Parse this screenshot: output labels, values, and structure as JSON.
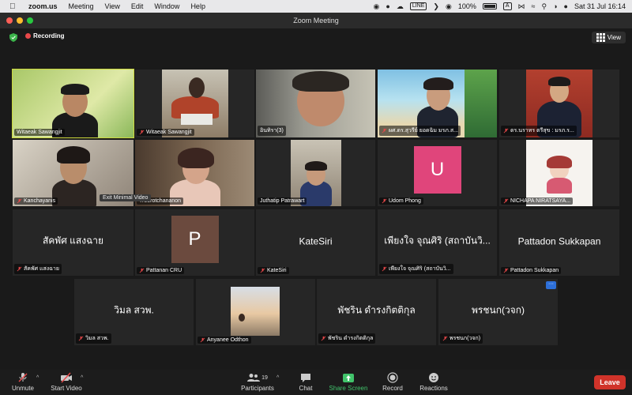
{
  "menubar": {
    "app": "zoom.us",
    "items": [
      "Meeting",
      "View",
      "Edit",
      "Window",
      "Help"
    ],
    "battery": "100%",
    "clock": "Sat 31 Jul  16:14",
    "line_badge": "LINE",
    "input_badge": "A"
  },
  "window": {
    "title": "Zoom Meeting"
  },
  "topbar": {
    "recording": "Recording",
    "view": "View"
  },
  "participants": [
    {
      "name": "Witaeak Sawangjit",
      "muted": false,
      "video": true,
      "active": true
    },
    {
      "name": "Witaeak Sawangjit",
      "muted": true,
      "video": true
    },
    {
      "name": "อินทิรา(3)",
      "muted": false,
      "video": true
    },
    {
      "name": "ผศ.ดร.สุวรีย์ ยอดฉิม มรภ.ส...",
      "muted": true,
      "video": true
    },
    {
      "name": "ดร.นราทร ตรีสุข : มรภ.ร...",
      "muted": true,
      "video": true
    },
    {
      "name": "Kanchayanis",
      "muted": true,
      "video": true
    },
    {
      "name": "Treerotchananon",
      "muted": false,
      "video": true
    },
    {
      "name": "Juthatip Patrawart",
      "muted": false,
      "video": true
    },
    {
      "name": "Udom Phong",
      "muted": true,
      "initial": "U",
      "color": "#e0457b"
    },
    {
      "name": "NICHAPA NIRATSAYA...",
      "muted": true,
      "video": true
    },
    {
      "name": "สัคพัศ แสงฉาย",
      "muted": true,
      "big_name": "สัคพัศ แสงฉาย"
    },
    {
      "name": "Pattanan CRU",
      "muted": true,
      "initial": "P",
      "color": "#6b4a3e"
    },
    {
      "name": "KateSiri",
      "muted": true,
      "big_name": "KateSiri"
    },
    {
      "name": "เพียงใจ จุณศิริ (สถาบันวิ...",
      "muted": true,
      "big_name": "เพียงใจ จุณศิริ (สถาบันวิ..."
    },
    {
      "name": "Pattadon Sukkapan",
      "muted": true,
      "big_name": "Pattadon Sukkapan"
    },
    {
      "name": "วิมล สวพ.",
      "muted": true,
      "big_name": "วิมล สวพ."
    },
    {
      "name": "Anyanee Odthon",
      "muted": true,
      "video": true
    },
    {
      "name": "พัชริน ดำรงกิตติกุล",
      "muted": true,
      "big_name": "พัชริน ดำรงกิตติกุล"
    },
    {
      "name": "พรชนก(วจก)",
      "muted": true,
      "big_name": "พรชนก(วจก)"
    }
  ],
  "overlay": {
    "exit_minimal": "Exit Minimal Video",
    "more": "···"
  },
  "toolbar": {
    "unmute": "Unmute",
    "start_video": "Start Video",
    "participants": "Participants",
    "participant_count": "19",
    "chat": "Chat",
    "share": "Share Screen",
    "record": "Record",
    "reactions": "Reactions",
    "leave": "Leave"
  },
  "colors": {
    "accent_green": "#41c36b",
    "leave_red": "#d0332a",
    "active_speaker": "#ccd93c",
    "recording_red": "#e8484a"
  }
}
